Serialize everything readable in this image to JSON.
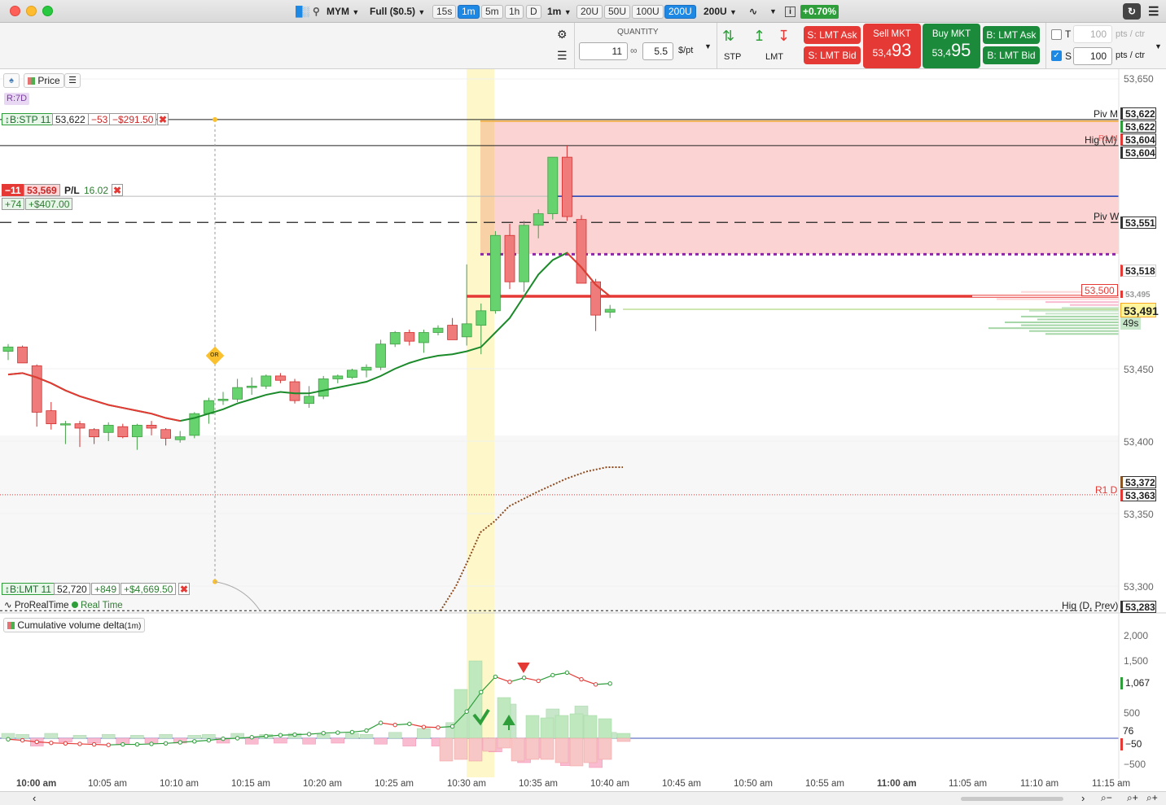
{
  "window": {
    "symbol": "MYM",
    "contract": "Full ($0.5)",
    "timeframes": [
      "15s",
      "1m",
      "5m",
      "1h",
      "D"
    ],
    "selected_timeframe": "1m",
    "interval": "1m",
    "ranges": [
      "20U",
      "50U",
      "100U",
      "200U"
    ],
    "selected_range": "200U",
    "range_dropdown": "200U",
    "change": "+0.70%"
  },
  "order_bar": {
    "quantity_label": "QUANTITY",
    "quantity": "11",
    "per_pt": "5.5",
    "per_pt_unit": "$/pt",
    "stp_label": "STP",
    "lmt_label": "LMT",
    "s_lmt_ask": "S: LMT Ask",
    "s_lmt_bid": "S: LMT Bid",
    "sell_mkt_label": "Sell MKT",
    "sell_price_small": "53,4",
    "sell_price_big": "93",
    "buy_mkt_label": "Buy MKT",
    "buy_price_small": "53,4",
    "buy_price_big": "95",
    "b_lmt_ask": "B: LMT Ask",
    "b_lmt_bid": "B: LMT Bid",
    "t_label": "T",
    "t_value": "100",
    "t_unit": "pts / ctr",
    "s_label": "S",
    "s_value": "100",
    "s_unit": "pts / ctr"
  },
  "chart_header": {
    "price_label": "Price",
    "range_badge": "R:7D"
  },
  "positions": {
    "stp_tag": "B:STP 11",
    "stp_price": "53,622",
    "stp_pts": "−53",
    "stp_pl": "−$291.50",
    "pos_qty": "−11",
    "pos_price": "53,569",
    "pos_pl_label": "P/L",
    "pos_pl_value": "16.02",
    "pos_pts": "+74",
    "pos_usd": "+$407.00",
    "lmt_tag": "B:LMT 11",
    "lmt_price": "52,720",
    "lmt_pts": "+849",
    "lmt_pl": "+$4,669.50"
  },
  "levels": {
    "piv_m": "Piv M",
    "hig_m": "Hig (M)",
    "r1m": "R1 M",
    "piv_w": "Piv W",
    "r1_d": "R1 D",
    "hig_d_prev": "Hig (D, Prev)",
    "or_label": "OR",
    "level_53500": "53,500"
  },
  "price_axis": {
    "labels": [
      "53,650",
      "53,450",
      "53,400",
      "53,350",
      "53,300"
    ],
    "boxes": [
      "53,622",
      "53,622",
      "53,604",
      "53,604",
      "53,551",
      "53,518",
      "53,495",
      "53,491",
      "49s",
      "53,372",
      "53,363",
      "53,283"
    ]
  },
  "footer": {
    "provider": "ProRealTime",
    "realtime": "Real Time"
  },
  "indicator": {
    "name": "Cumulative volume delta",
    "interval": "(1m)",
    "axis": [
      "2,000",
      "1,500",
      "1,067",
      "500",
      "76",
      "−50",
      "−500"
    ]
  },
  "time_axis": [
    "10:00 am",
    "10:05 am",
    "10:10 am",
    "10:15 am",
    "10:20 am",
    "10:25 am",
    "10:30 am",
    "10:35 am",
    "10:40 am",
    "10:45 am",
    "10:50 am",
    "10:55 am",
    "11:00 am",
    "11:05 am",
    "11:10 am",
    "11:15 am"
  ],
  "colors": {
    "up": "#4caf50",
    "down": "#e57373",
    "accent": "#1e88e5",
    "sell": "#e53935",
    "buy": "#1b8a3a"
  },
  "chart_data": {
    "type": "candlestick",
    "candles": [
      {
        "t": "10:00",
        "o": 53462,
        "h": 53467,
        "l": 53456,
        "c": 53465
      },
      {
        "t": "10:01",
        "o": 53465,
        "h": 53466,
        "l": 53454,
        "c": 53454
      },
      {
        "t": "10:02",
        "o": 53452,
        "h": 53453,
        "l": 53410,
        "c": 53420
      },
      {
        "t": "10:03",
        "o": 53421,
        "h": 53427,
        "l": 53408,
        "c": 53412
      },
      {
        "t": "10:04",
        "o": 53412,
        "h": 53414,
        "l": 53398,
        "c": 53412
      },
      {
        "t": "10:05",
        "o": 53412,
        "h": 53414,
        "l": 53396,
        "c": 53409
      },
      {
        "t": "10:06",
        "o": 53408,
        "h": 53409,
        "l": 53398,
        "c": 53403
      },
      {
        "t": "10:07",
        "o": 53406,
        "h": 53413,
        "l": 53400,
        "c": 53411
      },
      {
        "t": "10:08",
        "o": 53410,
        "h": 53412,
        "l": 53402,
        "c": 53403
      },
      {
        "t": "10:09",
        "o": 53403,
        "h": 53412,
        "l": 53394,
        "c": 53411
      },
      {
        "t": "10:10",
        "o": 53411,
        "h": 53414,
        "l": 53404,
        "c": 53409
      },
      {
        "t": "10:11",
        "o": 53408,
        "h": 53409,
        "l": 53397,
        "c": 53402
      },
      {
        "t": "10:12",
        "o": 53401,
        "h": 53407,
        "l": 53399,
        "c": 53403
      },
      {
        "t": "10:13",
        "o": 53404,
        "h": 53420,
        "l": 53402,
        "c": 53419
      },
      {
        "t": "10:14",
        "o": 53419,
        "h": 53430,
        "l": 53412,
        "c": 53428
      },
      {
        "t": "10:15",
        "o": 53428,
        "h": 53434,
        "l": 53425,
        "c": 53429
      },
      {
        "t": "10:16",
        "o": 53429,
        "h": 53443,
        "l": 53427,
        "c": 53437
      },
      {
        "t": "10:17",
        "o": 53437,
        "h": 53444,
        "l": 53432,
        "c": 53438
      },
      {
        "t": "10:18",
        "o": 53438,
        "h": 53446,
        "l": 53436,
        "c": 53445
      },
      {
        "t": "10:19",
        "o": 53445,
        "h": 53447,
        "l": 53440,
        "c": 53442
      },
      {
        "t": "10:20",
        "o": 53441,
        "h": 53443,
        "l": 53426,
        "c": 53428
      },
      {
        "t": "10:21",
        "o": 53426,
        "h": 53438,
        "l": 53423,
        "c": 53431
      },
      {
        "t": "10:22",
        "o": 53431,
        "h": 53445,
        "l": 53429,
        "c": 53443
      },
      {
        "t": "10:23",
        "o": 53443,
        "h": 53446,
        "l": 53440,
        "c": 53445
      },
      {
        "t": "10:24",
        "o": 53444,
        "h": 53450,
        "l": 53443,
        "c": 53449
      },
      {
        "t": "10:25",
        "o": 53449,
        "h": 53453,
        "l": 53444,
        "c": 53451
      },
      {
        "t": "10:26",
        "o": 53451,
        "h": 53470,
        "l": 53449,
        "c": 53467
      },
      {
        "t": "10:27",
        "o": 53467,
        "h": 53476,
        "l": 53465,
        "c": 53475
      },
      {
        "t": "10:28",
        "o": 53475,
        "h": 53477,
        "l": 53466,
        "c": 53469
      },
      {
        "t": "10:29",
        "o": 53468,
        "h": 53477,
        "l": 53461,
        "c": 53475
      },
      {
        "t": "10:30",
        "o": 53475,
        "h": 53480,
        "l": 53473,
        "c": 53478
      },
      {
        "t": "10:31",
        "o": 53480,
        "h": 53485,
        "l": 53470,
        "c": 53470
      },
      {
        "t": "10:32",
        "o": 53472,
        "h": 53522,
        "l": 53466,
        "c": 53481
      },
      {
        "t": "10:33",
        "o": 53480,
        "h": 53495,
        "l": 53460,
        "c": 53490
      },
      {
        "t": "10:34",
        "o": 53490,
        "h": 53545,
        "l": 53488,
        "c": 53542
      },
      {
        "t": "10:35",
        "o": 53542,
        "h": 53550,
        "l": 53505,
        "c": 53510
      },
      {
        "t": "10:36",
        "o": 53510,
        "h": 53552,
        "l": 53503,
        "c": 53549
      },
      {
        "t": "10:37",
        "o": 53549,
        "h": 53560,
        "l": 53540,
        "c": 53557
      },
      {
        "t": "10:38",
        "o": 53557,
        "h": 53596,
        "l": 53553,
        "c": 53596
      },
      {
        "t": "10:39",
        "o": 53596,
        "h": 53604,
        "l": 53552,
        "c": 53555
      },
      {
        "t": "10:40",
        "o": 53553,
        "h": 53556,
        "l": 53510,
        "c": 53509
      },
      {
        "t": "10:41",
        "o": 53510,
        "h": 53512,
        "l": 53476,
        "c": 53487
      },
      {
        "t": "10:42",
        "o": 53489,
        "h": 53494,
        "l": 53485,
        "c": 53491
      }
    ],
    "ema_fast": [
      53446,
      53447,
      53444,
      53440,
      53435,
      53431,
      53428,
      53425,
      53423,
      53421,
      53419,
      53416,
      53414,
      53416,
      53419,
      53422,
      53426,
      53429,
      53432,
      53434,
      53433,
      53433,
      53435,
      53437,
      53439,
      53441,
      53445,
      53450,
      53454,
      53457,
      53459,
      53460,
      53462,
      53465,
      53475,
      53485,
      53500,
      53515,
      53525,
      53530,
      53520,
      53508,
      53500
    ],
    "cvd_values": [
      -20,
      -40,
      -70,
      -90,
      -100,
      -110,
      -120,
      -130,
      -120,
      -120,
      -110,
      -100,
      -80,
      -60,
      -40,
      -10,
      0,
      20,
      40,
      60,
      70,
      80,
      100,
      110,
      120,
      150,
      300,
      260,
      280,
      220,
      210,
      230,
      520,
      900,
      1200,
      1100,
      1180,
      1120,
      1230,
      1280,
      1150,
      1050,
      1067
    ],
    "ylim": [
      53283,
      53650
    ],
    "y_ticks": [
      53650,
      53450,
      53400,
      53350,
      53300
    ],
    "xlabel": "",
    "ylabel": ""
  }
}
